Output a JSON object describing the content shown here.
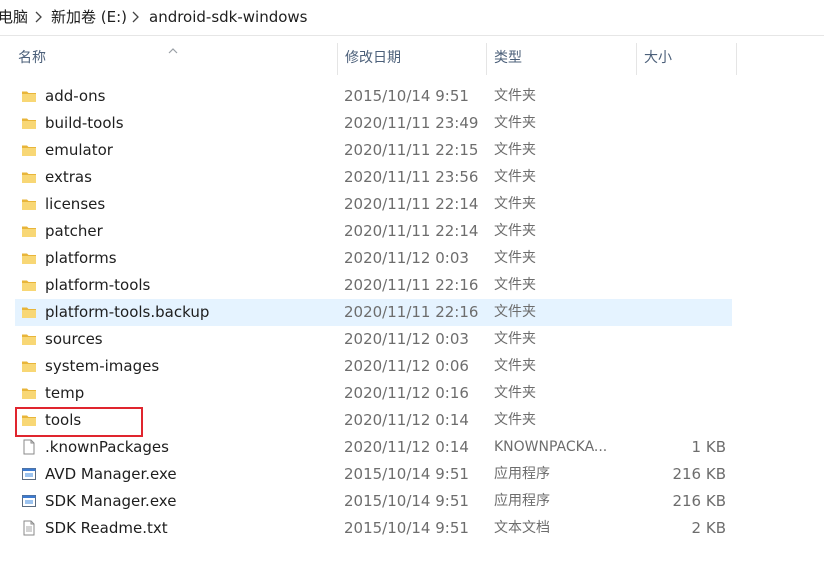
{
  "breadcrumb": {
    "items": [
      "电脑",
      "新加卷 (E:)",
      "android-sdk-windows"
    ]
  },
  "columns": {
    "name": "名称",
    "date": "修改日期",
    "type": "类型",
    "size": "大小"
  },
  "files": [
    {
      "name": "add-ons",
      "date": "2015/10/14 9:51",
      "type": "文件夹",
      "size": "",
      "icon": "folder-icon"
    },
    {
      "name": "build-tools",
      "date": "2020/11/11 23:49",
      "type": "文件夹",
      "size": "",
      "icon": "folder-icon"
    },
    {
      "name": "emulator",
      "date": "2020/11/11 22:15",
      "type": "文件夹",
      "size": "",
      "icon": "folder-icon"
    },
    {
      "name": "extras",
      "date": "2020/11/11 23:56",
      "type": "文件夹",
      "size": "",
      "icon": "folder-icon"
    },
    {
      "name": "licenses",
      "date": "2020/11/11 22:14",
      "type": "文件夹",
      "size": "",
      "icon": "folder-icon"
    },
    {
      "name": "patcher",
      "date": "2020/11/11 22:14",
      "type": "文件夹",
      "size": "",
      "icon": "folder-icon"
    },
    {
      "name": "platforms",
      "date": "2020/11/12 0:03",
      "type": "文件夹",
      "size": "",
      "icon": "folder-icon"
    },
    {
      "name": "platform-tools",
      "date": "2020/11/11 22:16",
      "type": "文件夹",
      "size": "",
      "icon": "folder-icon"
    },
    {
      "name": "platform-tools.backup",
      "date": "2020/11/11 22:16",
      "type": "文件夹",
      "size": "",
      "icon": "folder-icon",
      "selected": true
    },
    {
      "name": "sources",
      "date": "2020/11/12 0:03",
      "type": "文件夹",
      "size": "",
      "icon": "folder-icon"
    },
    {
      "name": "system-images",
      "date": "2020/11/12 0:06",
      "type": "文件夹",
      "size": "",
      "icon": "folder-icon"
    },
    {
      "name": "temp",
      "date": "2020/11/12 0:16",
      "type": "文件夹",
      "size": "",
      "icon": "folder-icon"
    },
    {
      "name": "tools",
      "date": "2020/11/12 0:14",
      "type": "文件夹",
      "size": "",
      "icon": "folder-icon"
    },
    {
      "name": ".knownPackages",
      "date": "2020/11/12 0:14",
      "type": "KNOWNPACKA...",
      "size": "1 KB",
      "icon": "file-icon"
    },
    {
      "name": "AVD Manager.exe",
      "date": "2015/10/14 9:51",
      "type": "应用程序",
      "size": "216 KB",
      "icon": "exe-icon"
    },
    {
      "name": "SDK Manager.exe",
      "date": "2015/10/14 9:51",
      "type": "应用程序",
      "size": "216 KB",
      "icon": "exe-icon"
    },
    {
      "name": "SDK Readme.txt",
      "date": "2015/10/14 9:51",
      "type": "文本文档",
      "size": "2 KB",
      "icon": "text-file-icon"
    }
  ],
  "colors": {
    "selection": "#e5f3ff",
    "highlight_box": "#e0252e",
    "folder": "#f8d775"
  }
}
